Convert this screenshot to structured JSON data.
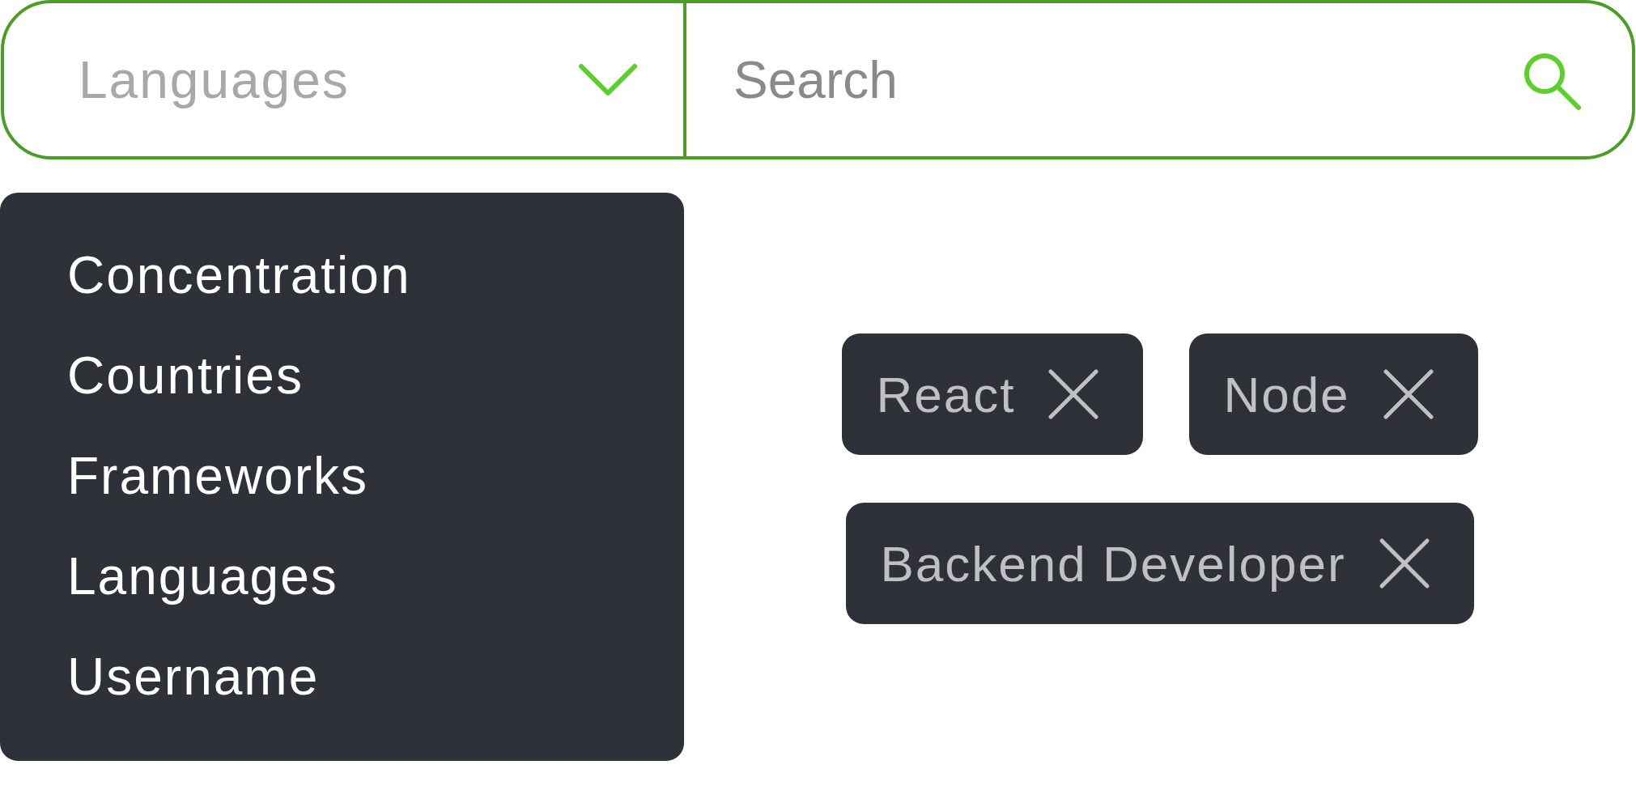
{
  "filter_bar": {
    "category": "Languages",
    "search": {
      "placeholder": "Search"
    }
  },
  "dropdown": {
    "items": [
      {
        "label": "Concentration"
      },
      {
        "label": "Countries"
      },
      {
        "label": "Frameworks"
      },
      {
        "label": "Languages"
      },
      {
        "label": "Username"
      }
    ]
  },
  "tags": [
    {
      "label": "React"
    },
    {
      "label": "Node"
    },
    {
      "label": "Backend Developer"
    }
  ]
}
